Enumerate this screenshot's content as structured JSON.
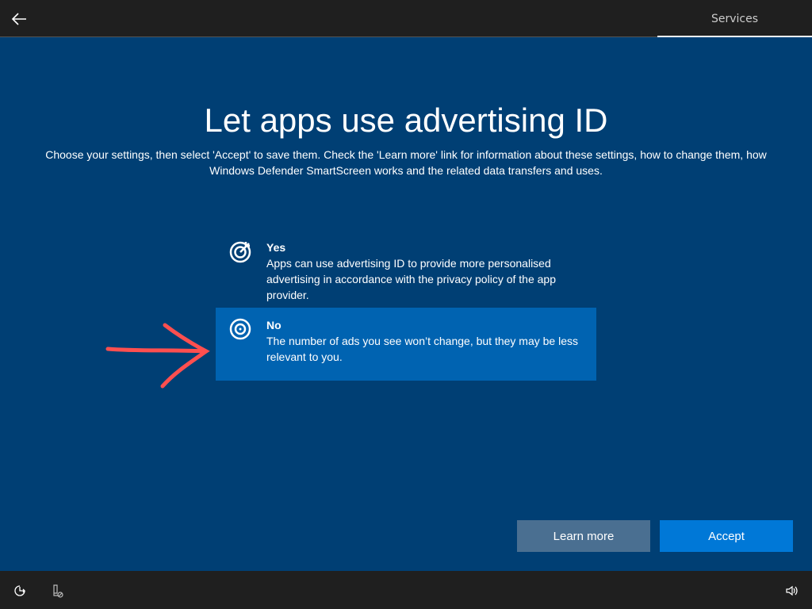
{
  "header": {
    "tab": "Services"
  },
  "title": "Let apps use advertising ID",
  "subtitle": "Choose your settings, then select 'Accept' to save them. Check the 'Learn more' link for information about these settings, how to change them, how Windows Defender SmartScreen works and the related data transfers and uses.",
  "options": [
    {
      "label": "Yes",
      "desc": "Apps can use advertising ID to provide more personalised advertising in accordance with the privacy policy of the app provider."
    },
    {
      "label": "No",
      "desc": "The number of ads you see won’t change, but they may be less relevant to you.",
      "selected": true
    }
  ],
  "buttons": {
    "learn_more": "Learn more",
    "accept": "Accept"
  },
  "colors": {
    "background": "#003f74",
    "selected": "#0063b1",
    "accept": "#0078d7",
    "annotation": "#ff4f4f"
  }
}
